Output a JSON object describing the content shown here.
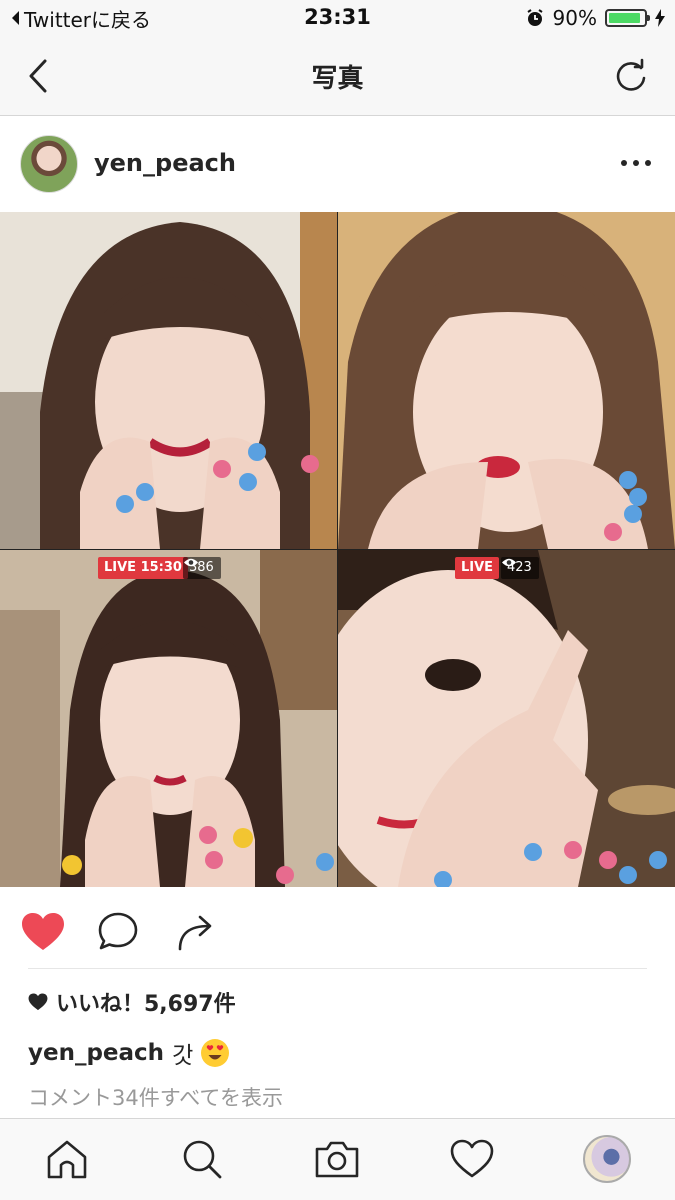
{
  "status_bar": {
    "back_app": "Twitterに戻る",
    "time": "23:31",
    "battery": "90%",
    "battery_level": 0.9,
    "icons": [
      "back-arrow-icon",
      "alarm-icon",
      "battery-icon",
      "charging-icon"
    ]
  },
  "nav": {
    "title": "写真",
    "icons": [
      "chevron-left-icon",
      "refresh-icon"
    ]
  },
  "post": {
    "username": "yen_peach",
    "photo": {
      "tiles": [
        {
          "position": "top-left"
        },
        {
          "position": "top-right"
        },
        {
          "position": "bottom-left",
          "live_label": "LIVE 15:30",
          "viewers": "386"
        },
        {
          "position": "bottom-right",
          "live_label": "LIVE",
          "viewers": "423"
        }
      ]
    },
    "actions": {
      "liked": true,
      "icons": [
        "heart-filled-icon",
        "comment-icon",
        "share-icon"
      ]
    },
    "likes_text": "いいね！5,697件",
    "caption": {
      "username": "yen_peach",
      "text": "갓",
      "emoji": "heart-eyes-emoji"
    },
    "comments_link": "コメント34件すべてを表示"
  },
  "tab_bar": {
    "icons": [
      "home-icon",
      "search-icon",
      "camera-icon",
      "heart-icon",
      "profile-avatar"
    ]
  },
  "colors": {
    "like_red": "#ed4956",
    "live_red": "#e0383e",
    "battery_green": "#4cd964",
    "text": "#262626",
    "muted": "#999999"
  }
}
